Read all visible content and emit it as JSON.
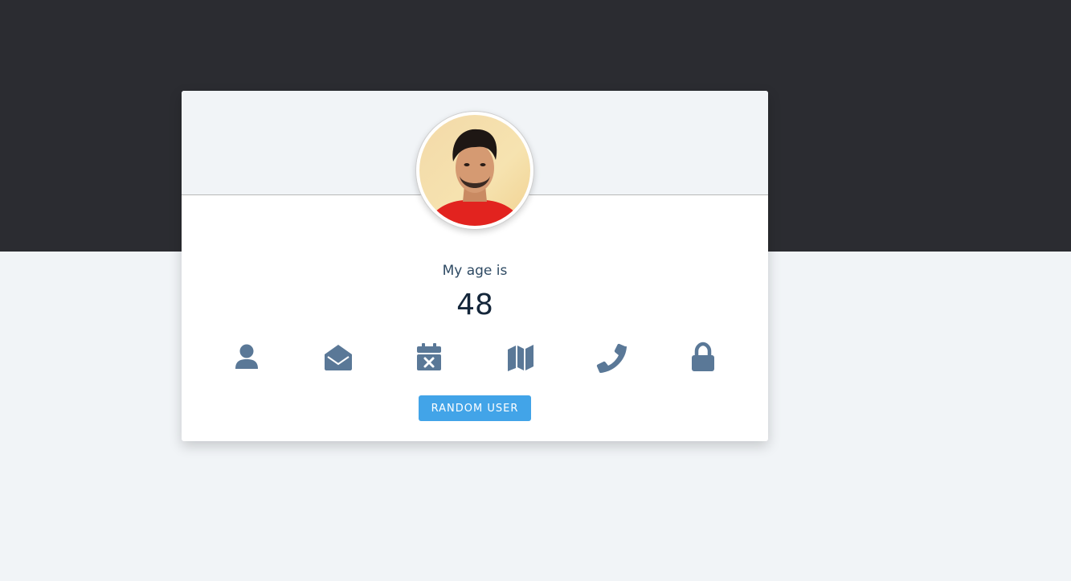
{
  "profile": {
    "label": "My age is",
    "value": "48"
  },
  "icons": [
    {
      "name": "user-icon"
    },
    {
      "name": "envelope-open-icon"
    },
    {
      "name": "calendar-x-icon"
    },
    {
      "name": "map-icon"
    },
    {
      "name": "phone-icon"
    },
    {
      "name": "lock-icon"
    }
  ],
  "button": {
    "label": "RANDOM USER"
  },
  "colors": {
    "dark_band": "#2b2c31",
    "page_bg": "#f1f4f7",
    "icon": "#5a7897",
    "button": "#42a4e8"
  }
}
